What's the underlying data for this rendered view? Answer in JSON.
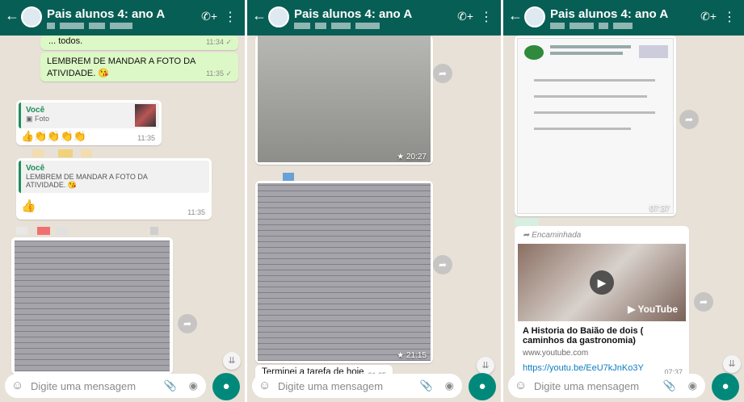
{
  "chat_title": "Pais alunos 4: ano A",
  "header_icons": {
    "back": "back-arrow-icon",
    "avatar": "group-avatar",
    "call": "add-call-icon",
    "menu": "more-vert-icon"
  },
  "footer": {
    "placeholder": "Digite uma mensagem",
    "emoji": "emoji-icon",
    "attach": "attach-icon",
    "camera": "camera-icon",
    "mic": "mic-icon"
  },
  "panel1": {
    "msg_partial": "... todos.",
    "msg_partial_time": "11:34 ✓",
    "msg_remember": "LEMBREM DE MANDAR A FOTO DA ATIVIDADE. 😘",
    "msg_remember_time": "11:35 ✓",
    "reply1_author": "Você",
    "reply1_text": "Foto",
    "reply1_emojis": "👍👏👏👏👏",
    "reply1_time": "11:35",
    "reply2_author": "Você",
    "reply2_text": "LEMBREM DE MANDAR A FOTO DA ATIVIDADE. 😘",
    "reply2_emoji": "👍",
    "reply2_time": "11:35"
  },
  "panel2": {
    "img1_time": "★ 20:27",
    "img2_time": "★ 21:15",
    "msg_done": "Terminei a tarefa de hoje",
    "msg_done_time": "21:25"
  },
  "panel3": {
    "img_time": "07:37",
    "forwarded": "Encaminhada",
    "yt_logo": "YouTube",
    "video_title": "A Historia do Baião de dois ( caminhos da gastronomia)",
    "video_domain": "www.youtube.com",
    "video_link": "https://youtu.be/EeU7kJnKo3Y",
    "video_time": "07:37"
  },
  "colors": {
    "header": "#075e54",
    "outgoing": "#dcf8c6",
    "mic": "#00897b",
    "link": "#0a7dbf"
  }
}
